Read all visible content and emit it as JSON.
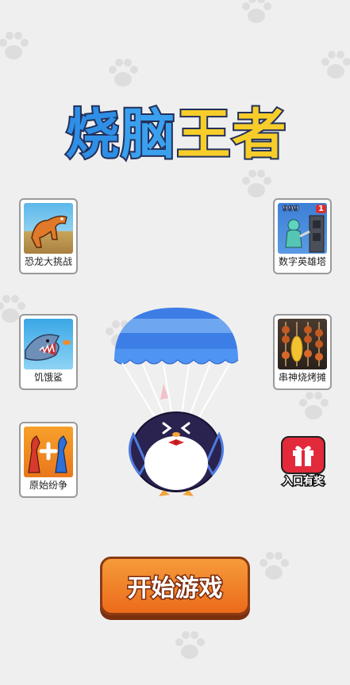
{
  "title": {
    "c1": "烧",
    "c2": "脑",
    "c3": "王",
    "c4": "者"
  },
  "games_left": [
    {
      "label": "恐龙大挑战",
      "icon": "dinosaur-icon"
    },
    {
      "label": "饥饿鲨",
      "icon": "shark-icon"
    },
    {
      "label": "原始纷争",
      "icon": "dinosaur-merge-icon"
    }
  ],
  "games_right": [
    {
      "label": "数字英雄塔",
      "icon": "hero-tower-icon",
      "badge_a": "999",
      "badge_b": "1"
    },
    {
      "label": "串神烧烤摊",
      "icon": "barbecue-icon"
    }
  ],
  "gift": {
    "label": "入口有奖",
    "icon": "gift-icon"
  },
  "start_button": {
    "label": "开始游戏"
  },
  "colors": {
    "accent": "#ec6b1b",
    "title_blue": "#2f8fe6",
    "title_yellow": "#f7cd2a",
    "background": "#efefef"
  }
}
